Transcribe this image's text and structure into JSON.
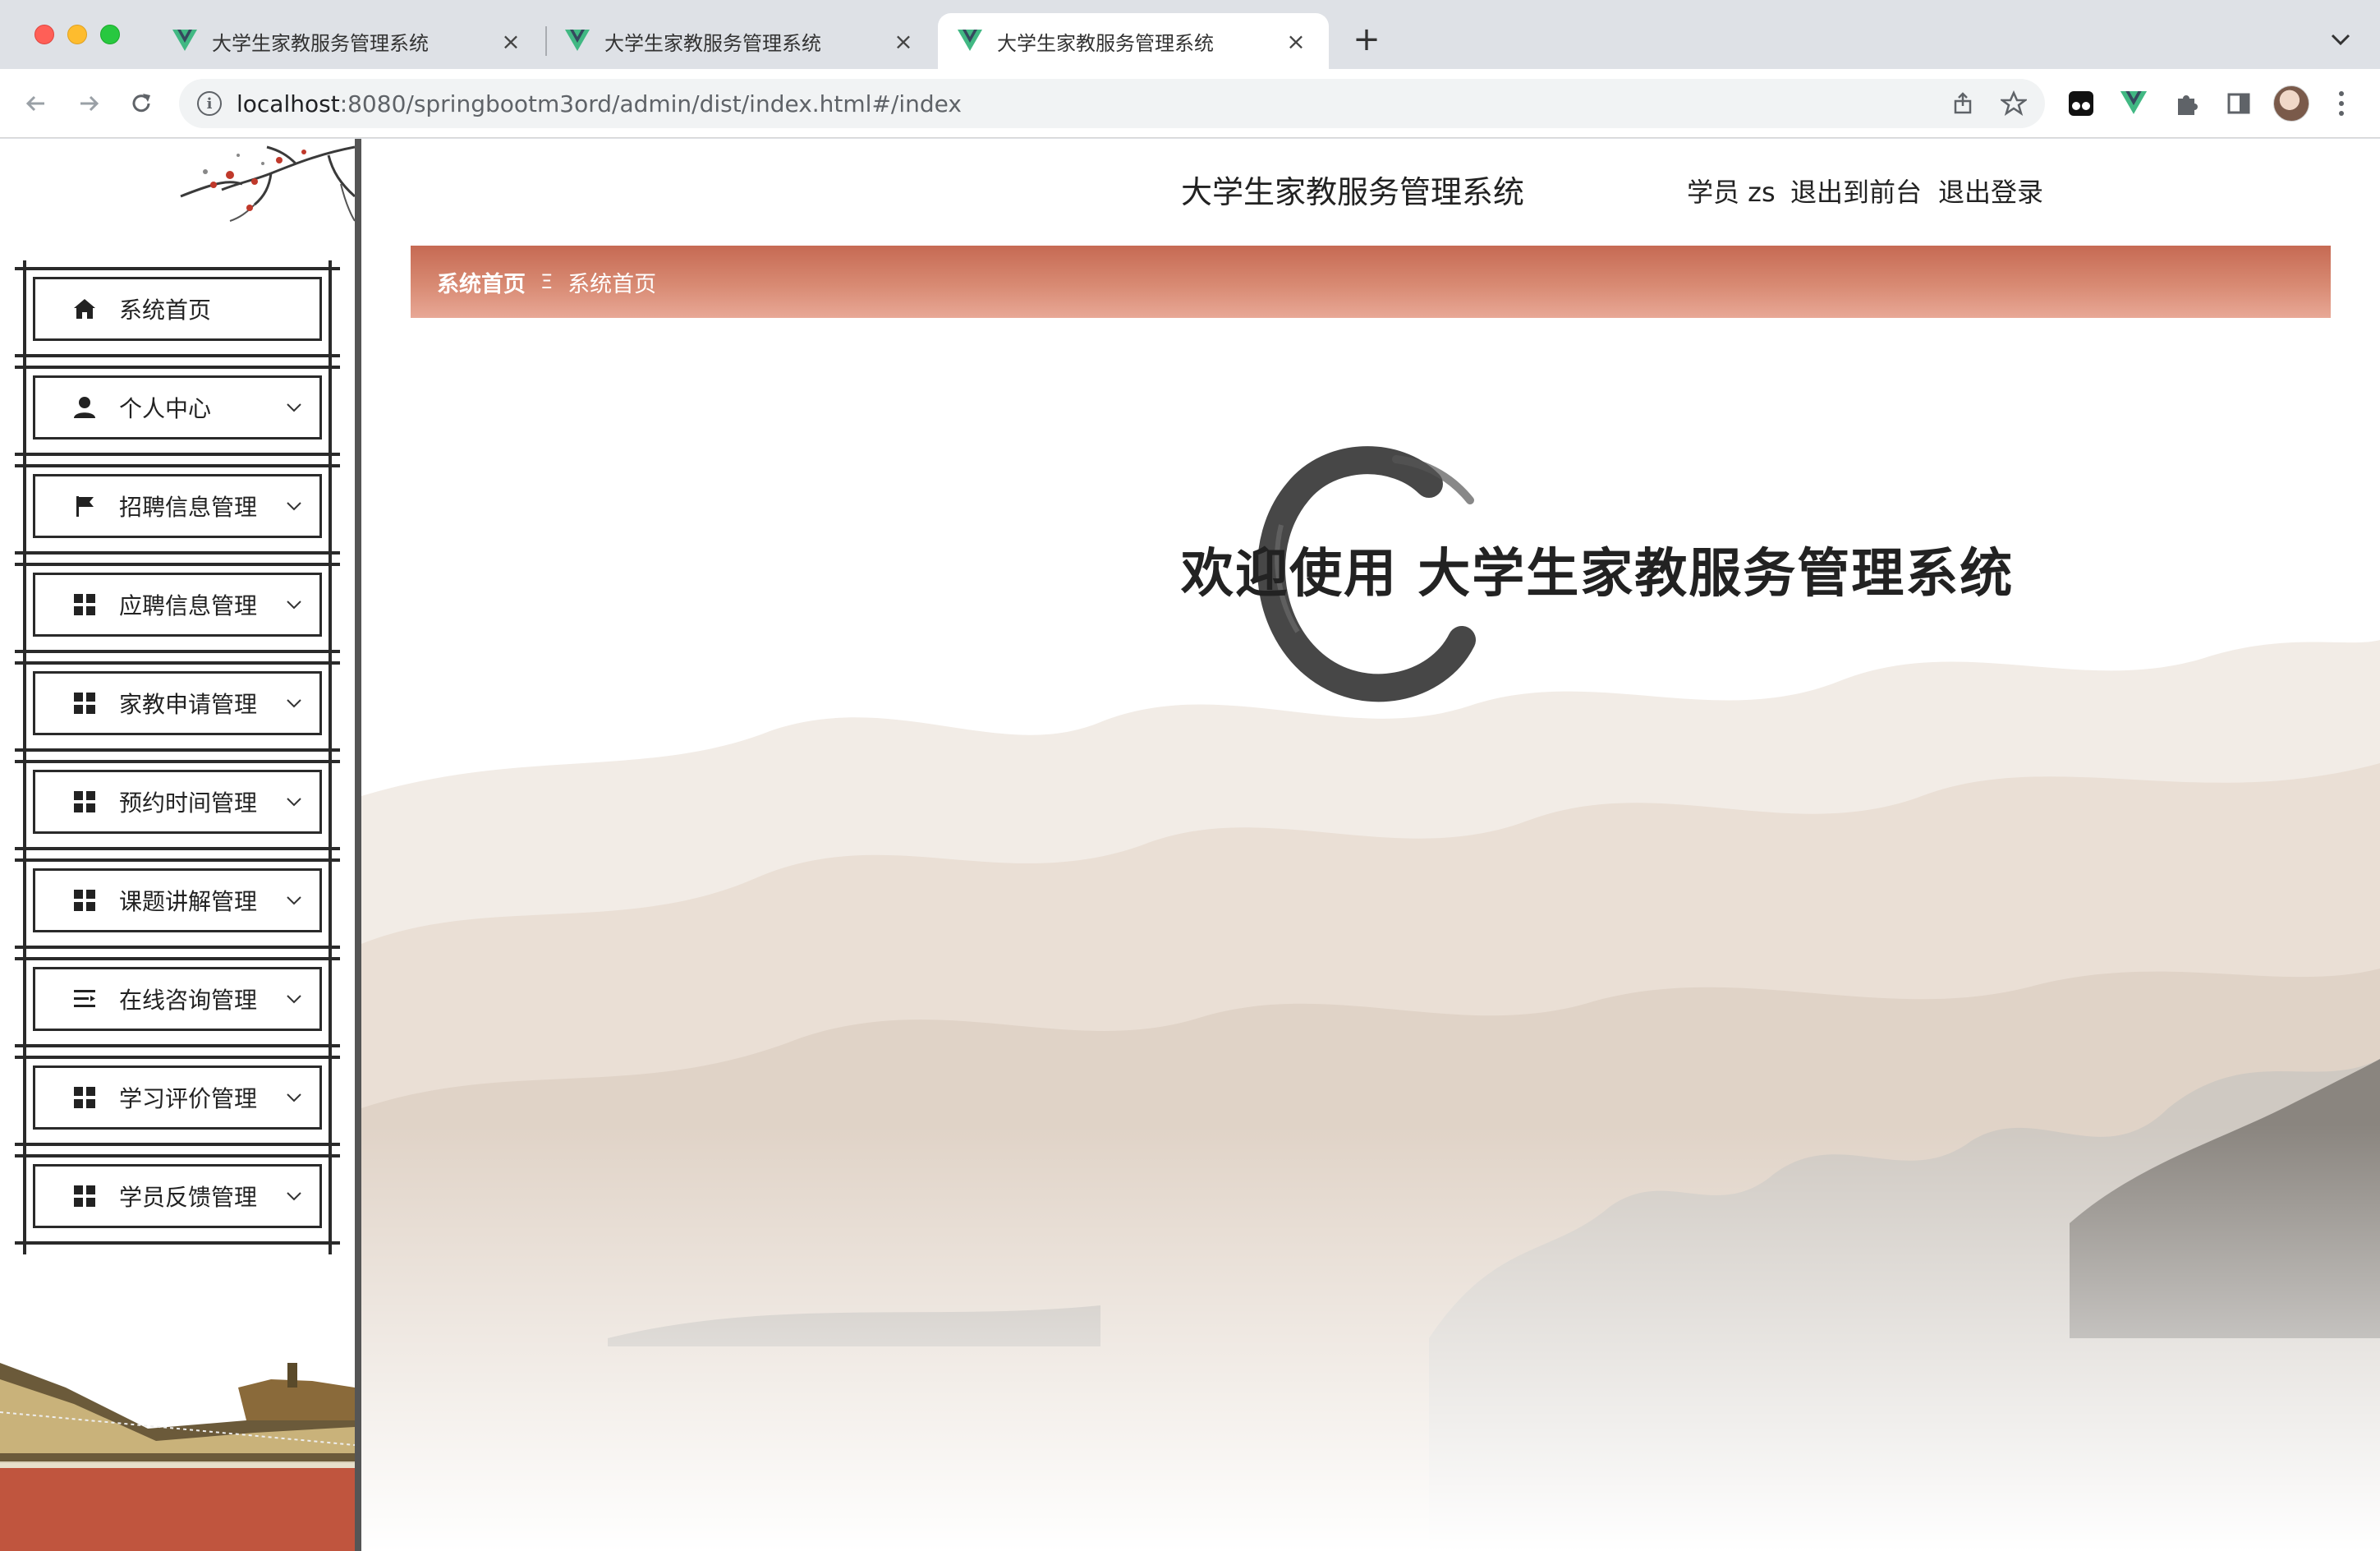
{
  "browser": {
    "tabs": [
      {
        "title": "大学生家教服务管理系统",
        "close": "×"
      },
      {
        "title": "大学生家教服务管理系统",
        "close": "×"
      },
      {
        "title": "大学生家教服务管理系统",
        "close": "×"
      }
    ],
    "new_tab": "+",
    "url_host": "localhost",
    "url_rest": ":8080/springbootm3ord/admin/dist/index.html#/index"
  },
  "sidebar": {
    "items": [
      {
        "label": "系统首页",
        "icon": "home-icon"
      },
      {
        "label": "个人中心",
        "icon": "user-icon"
      },
      {
        "label": "招聘信息管理",
        "icon": "flag-icon"
      },
      {
        "label": "应聘信息管理",
        "icon": "grid-icon"
      },
      {
        "label": "家教申请管理",
        "icon": "grid-icon"
      },
      {
        "label": "预约时间管理",
        "icon": "grid-icon"
      },
      {
        "label": "课题讲解管理",
        "icon": "grid-icon"
      },
      {
        "label": "在线咨询管理",
        "icon": "list-icon"
      },
      {
        "label": "学习评价管理",
        "icon": "grid-icon"
      },
      {
        "label": "学员反馈管理",
        "icon": "grid-icon"
      }
    ]
  },
  "header": {
    "title": "大学生家教服务管理系统",
    "user": "学员 zs",
    "back_to_front": "退出到前台",
    "logout": "退出登录"
  },
  "breadcrumb": {
    "first": "系统首页",
    "separator": "Ξ",
    "second": "系统首页"
  },
  "main": {
    "welcome": "欢迎使用 大学生家教服务管理系统"
  },
  "colors": {
    "breadcrumb_bar": "#c66a53",
    "sidebar_border": "#555555"
  }
}
